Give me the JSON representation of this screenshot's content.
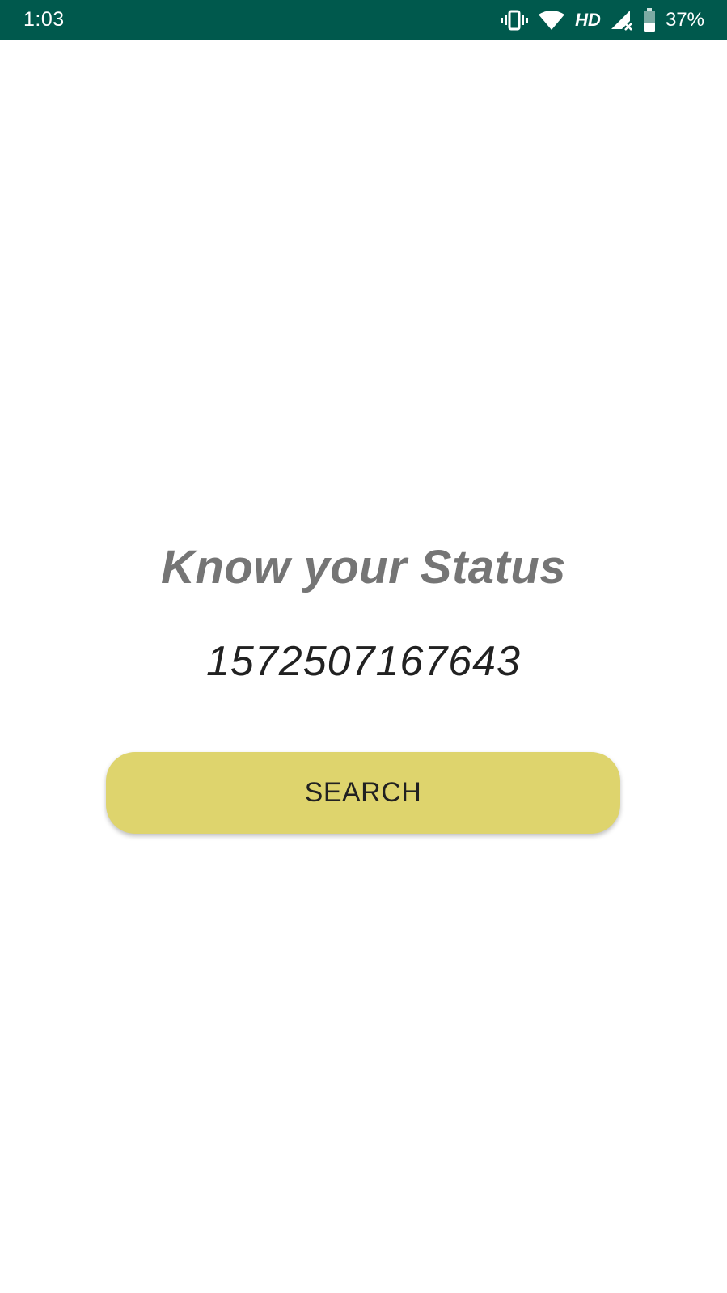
{
  "status_bar": {
    "time": "1:03",
    "network_label": "HD",
    "battery_percent": "37%",
    "background_color": "#00594d",
    "icons": [
      "vibrate-icon",
      "wifi-icon",
      "signal-icon",
      "battery-icon"
    ]
  },
  "main": {
    "title": "Know your Status",
    "id_value": "1572507167643",
    "search_button_label": "SEARCH",
    "button_color": "#ded46d",
    "title_color": "#757575"
  }
}
